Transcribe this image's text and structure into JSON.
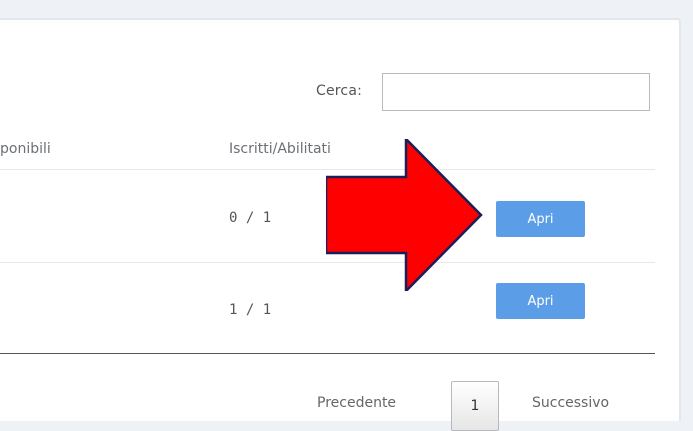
{
  "search": {
    "label": "Cerca:",
    "value": "",
    "placeholder": ""
  },
  "table": {
    "headers": [
      "ponibili",
      "Iscritti/Abilitati"
    ],
    "rows": [
      {
        "enrolled": "0 / 1",
        "action_label": "Apri"
      },
      {
        "enrolled": "1 / 1",
        "action_label": "Apri"
      }
    ]
  },
  "pagination": {
    "prev_label": "Precedente",
    "current_page": "1",
    "next_label": "Successivo"
  },
  "annotation": {
    "arrow_icon": "red-arrow-right-icon",
    "arrow_color": "#ff0000"
  },
  "colors": {
    "button_bg": "#5b9de6",
    "button_text": "#ffffff"
  }
}
